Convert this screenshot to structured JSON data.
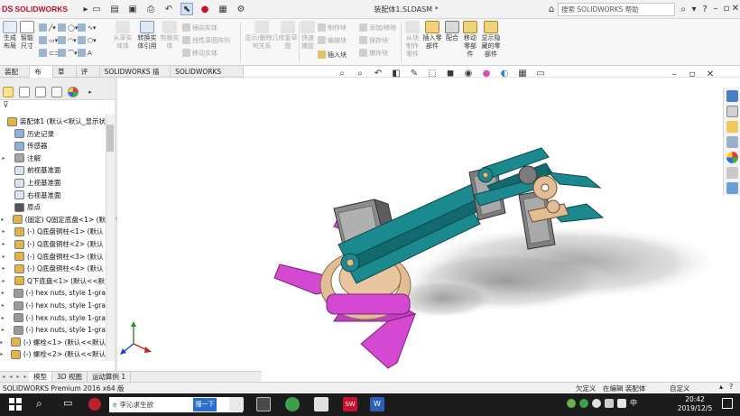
{
  "app": {
    "brand_prefix": "DS",
    "brand_name": "SOLIDWORKS",
    "document_title": "装配体1.SLDASM *",
    "help_search_placeholder": "搜索 SOLIDWORKS 帮助"
  },
  "ribbon": {
    "groups": [
      {
        "id": "generate-layout",
        "label": "生成布局",
        "enabled": true
      },
      {
        "id": "smart-dimension",
        "label": "智能尺寸",
        "enabled": true
      },
      {
        "id": "block-from-entities",
        "label": "从草实体体",
        "enabled": false
      },
      {
        "id": "convert-entities",
        "label": "转换实体引用",
        "enabled": true
      },
      {
        "id": "trim-entities",
        "label": "剪裁实体",
        "enabled": false
      },
      {
        "id": "sketch-mirror",
        "label": "镜向实体",
        "enabled": false
      },
      {
        "id": "linear-pattern",
        "label": "线性草图阵列",
        "enabled": false
      },
      {
        "id": "move-entities",
        "label": "移动实体",
        "enabled": false
      },
      {
        "id": "display-relations",
        "label": "显示/删除几何关系",
        "enabled": false
      },
      {
        "id": "repair-sketch",
        "label": "修复草图",
        "enabled": false
      },
      {
        "id": "quick-snap",
        "label": "快速捕捉",
        "enabled": false
      },
      {
        "id": "make-block",
        "label": "制作块",
        "enabled": false
      },
      {
        "id": "edit-block",
        "label": "编辑块",
        "enabled": false
      },
      {
        "id": "insert-block",
        "label": "插入块",
        "enabled": true
      },
      {
        "id": "add-remove",
        "label": "添加/移除",
        "enabled": false
      },
      {
        "id": "rebuild",
        "label": "保存块",
        "enabled": false
      },
      {
        "id": "explode-block",
        "label": "爆炸块",
        "enabled": false
      },
      {
        "id": "make-part",
        "label": "从块制作零件",
        "enabled": false
      },
      {
        "id": "insert-part",
        "label": "插入零部件",
        "enabled": true
      },
      {
        "id": "mate",
        "label": "配合",
        "enabled": true
      },
      {
        "id": "move-component",
        "label": "移动零部件",
        "enabled": true
      },
      {
        "id": "show-hidden",
        "label": "显示隐藏的零部件",
        "enabled": true
      }
    ]
  },
  "tabs": [
    {
      "label": "装配体",
      "active": false
    },
    {
      "label": "布局",
      "active": true
    },
    {
      "label": "草图",
      "active": false
    },
    {
      "label": "评估",
      "active": false
    },
    {
      "label": "SOLIDWORKS 插件",
      "active": false
    },
    {
      "label": "SOLIDWORKS MBD",
      "active": false
    }
  ],
  "feature_tree": {
    "items": [
      {
        "label": "装配体1 (默认<默认_显示状",
        "icon": "assembly-icon",
        "expand": "",
        "level": 0
      },
      {
        "label": "历史记录",
        "icon": "history-icon",
        "expand": "",
        "level": 1
      },
      {
        "label": "传感器",
        "icon": "sensor-icon",
        "expand": "",
        "level": 1
      },
      {
        "label": "注解",
        "icon": "annotation-icon",
        "expand": "▸",
        "level": 1
      },
      {
        "label": "前视基准面",
        "icon": "plane-icon",
        "expand": "",
        "level": 1
      },
      {
        "label": "上视基准面",
        "icon": "plane-icon",
        "expand": "",
        "level": 1
      },
      {
        "label": "右视基准面",
        "icon": "plane-icon",
        "expand": "",
        "level": 1
      },
      {
        "label": "原点",
        "icon": "origin-icon",
        "expand": "",
        "level": 1
      },
      {
        "label": "(固定) Q固定底盘<1> (默",
        "icon": "part-icon",
        "expand": "▸",
        "level": 1
      },
      {
        "label": "(-) Q底盘铜柱<1> (默认",
        "icon": "part-icon",
        "expand": "▸",
        "level": 1
      },
      {
        "label": "(-) Q底盘铜柱<2> (默认",
        "icon": "part-icon",
        "expand": "▸",
        "level": 1
      },
      {
        "label": "(-) Q底盘铜柱<3> (默认",
        "icon": "part-icon",
        "expand": "▸",
        "level": 1
      },
      {
        "label": "(-) Q底盘铜柱<4> (默认",
        "icon": "part-icon",
        "expand": "▸",
        "level": 1
      },
      {
        "label": "Q下底盘<1> (默认<<默",
        "icon": "part-icon",
        "expand": "▸",
        "level": 1
      },
      {
        "label": "(-) hex nuts, style 1-gra",
        "icon": "fastener-icon",
        "expand": "▸",
        "level": 1
      },
      {
        "label": "(-) hex nuts, style 1-gra",
        "icon": "fastener-icon",
        "expand": "▸",
        "level": 1
      },
      {
        "label": "(-) hex nuts, style 1-gra",
        "icon": "fastener-icon",
        "expand": "▸",
        "level": 1
      },
      {
        "label": "(-) hex nuts, style 1-gra",
        "icon": "fastener-icon",
        "expand": "▸",
        "level": 1
      },
      {
        "label": "(-) 螺栓<1> (默认<<默认",
        "icon": "part-icon",
        "expand": "▸",
        "level": 1
      },
      {
        "label": "(-) 螺栓<2> (默认<<默认",
        "icon": "part-icon",
        "expand": "▸",
        "level": 1
      }
    ]
  },
  "bottom_tabs": [
    {
      "label": "模型",
      "active": true
    },
    {
      "label": "3D 视图",
      "active": false
    },
    {
      "label": "运动算例 1",
      "active": false
    }
  ],
  "status": {
    "product": "SOLIDWORKS Premium 2016 x64 版",
    "definition": "欠定义",
    "mode": "在编辑 装配体",
    "units": "自定义"
  },
  "taskbar": {
    "search_text": "李沁求生欲",
    "search_button": "搜一下",
    "time": "20:42",
    "date": "2019/12/5"
  },
  "colors": {
    "arm_teal": "#1a8a8e",
    "base_magenta": "#d548d2",
    "base_tan": "#e2bd93",
    "servo_gray": "#8b8b8b",
    "accent_brand": "#c8102e"
  }
}
